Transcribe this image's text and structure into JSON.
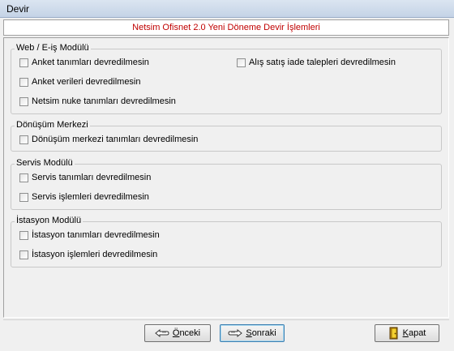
{
  "window": {
    "title": "Devir"
  },
  "header": {
    "text": "Netsim Ofisnet 2.0 Yeni Döneme Devir İşlemleri"
  },
  "groups": {
    "web": {
      "label": "Web / E-iş Modülü",
      "items": [
        {
          "label": "Anket tanımları devredilmesin",
          "checked": false
        },
        {
          "label": "Anket verileri devredilmesin",
          "checked": false
        },
        {
          "label": "Netsim nuke tanımları devredilmesin",
          "checked": false
        },
        {
          "label": "Alış satış iade talepleri devredilmesin",
          "checked": false
        }
      ]
    },
    "conversion": {
      "label": "Dönüşüm Merkezi",
      "items": [
        {
          "label": "Dönüşüm merkezi tanımları devredilmesin",
          "checked": false
        }
      ]
    },
    "service": {
      "label": "Servis Modülü",
      "items": [
        {
          "label": "Servis tanımları devredilmesin",
          "checked": false
        },
        {
          "label": "Servis işlemleri devredilmesin",
          "checked": false
        }
      ]
    },
    "station": {
      "label": "İstasyon Modülü",
      "items": [
        {
          "label": "İstasyon tanımları devredilmesin",
          "checked": false
        },
        {
          "label": "İstasyon işlemleri devredilmesin",
          "checked": false
        }
      ]
    }
  },
  "buttons": {
    "prev": {
      "accel": "Ö",
      "rest": "nceki",
      "icon": "hand-pointing-left-icon"
    },
    "next": {
      "accel": "S",
      "rest": "onraki",
      "icon": "hand-pointing-right-icon"
    },
    "close": {
      "accel": "K",
      "rest": "apat",
      "icon": "door-exit-icon"
    }
  }
}
